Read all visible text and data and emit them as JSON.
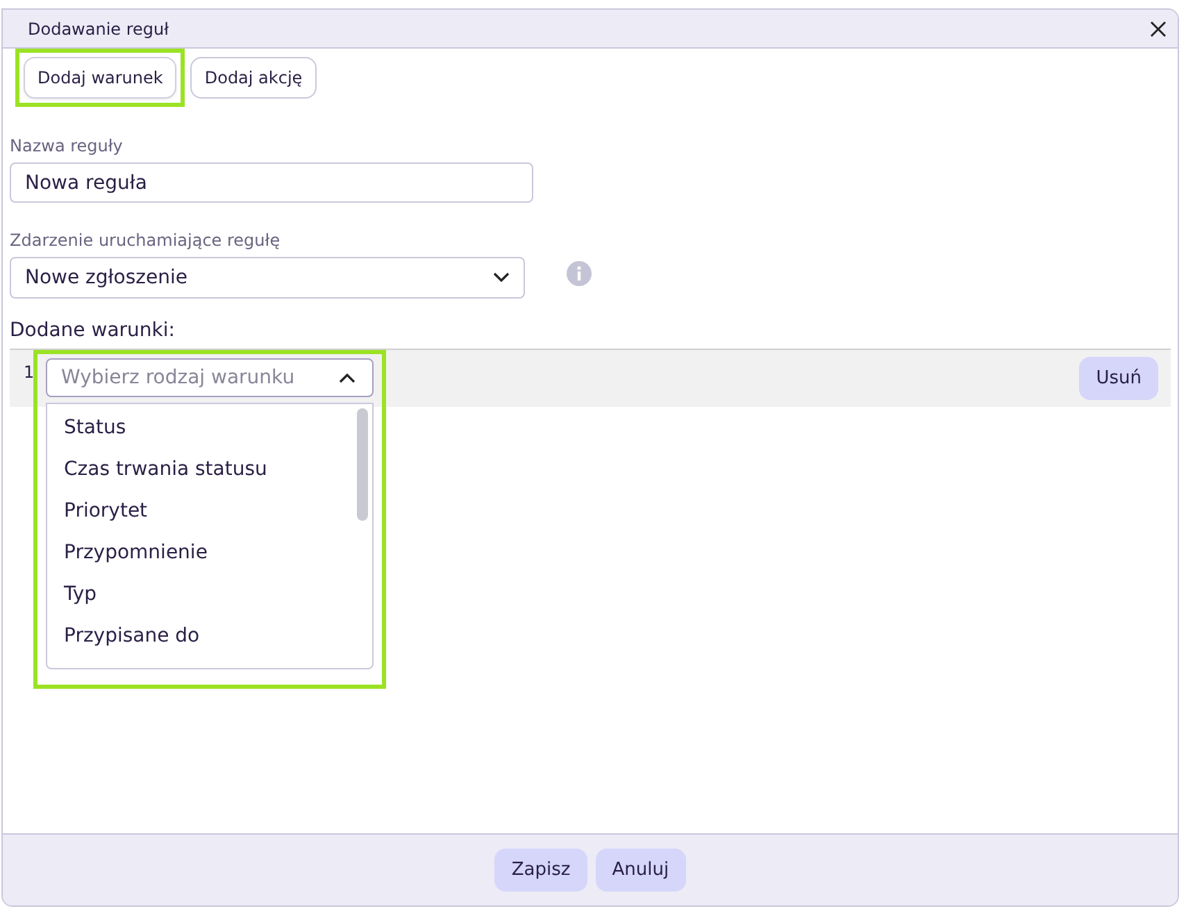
{
  "window": {
    "title": "Dodawanie reguł"
  },
  "tabs": [
    {
      "label": "Dodaj warunek",
      "selected": true,
      "highlighted": true
    },
    {
      "label": "Dodaj akcję",
      "selected": false,
      "highlighted": false
    }
  ],
  "rule_name": {
    "label": "Nazwa reguły",
    "value": "Nowa reguła"
  },
  "trigger": {
    "label": "Zdarzenie uruchamiające regułę",
    "value": "Nowe zgłoszenie"
  },
  "conditions": {
    "label": "Dodane warunki:",
    "rows": [
      {
        "number": "1",
        "placeholder": "Wybierz rodzaj warunku",
        "expanded": true,
        "highlighted": true,
        "remove": "Usuń",
        "options": [
          "Status",
          "Czas trwania statusu",
          "Priorytet",
          "Przypomnienie",
          "Typ",
          "Przypisane do"
        ]
      }
    ]
  },
  "buttons": [
    "Zapisz",
    "Anuluj"
  ]
}
